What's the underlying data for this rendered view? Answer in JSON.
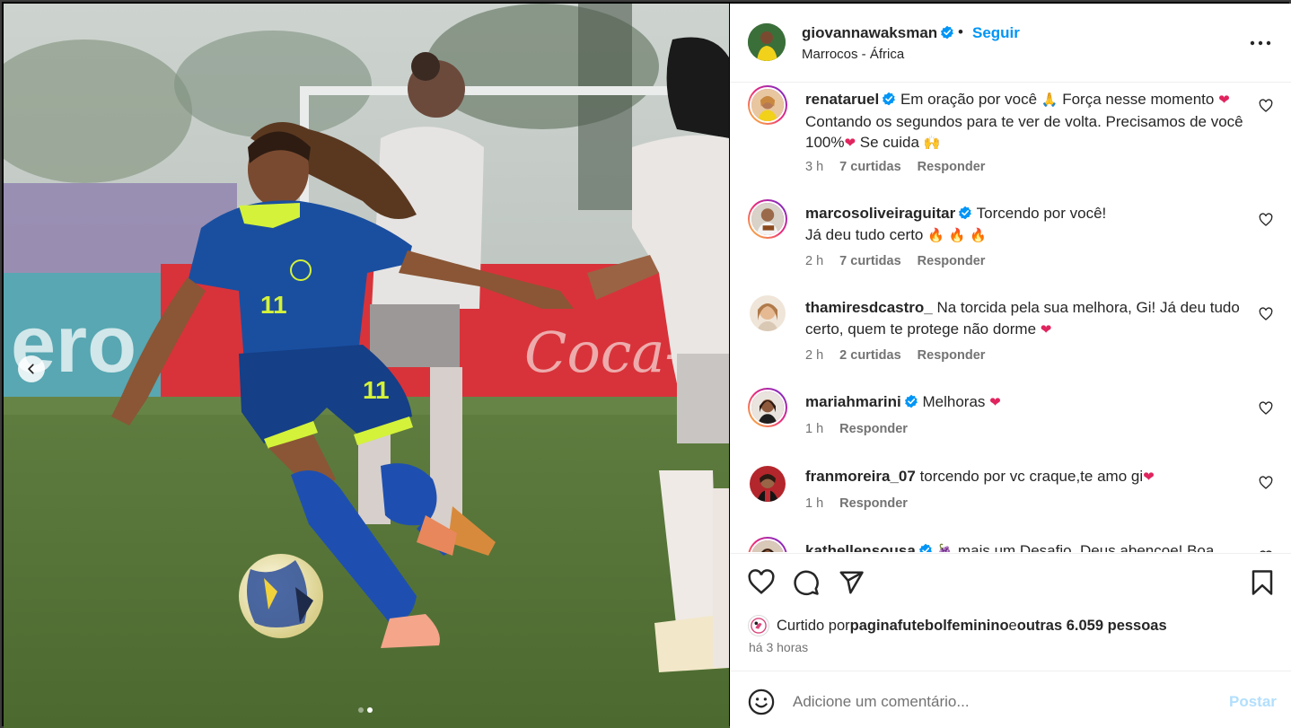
{
  "post": {
    "username": "giovannawaksman",
    "separator": "•",
    "follow_label": "Seguir",
    "location": "Marrocos - África"
  },
  "comments": [
    {
      "username": "renataruel",
      "text_a": "Em oração por você ",
      "emoji_a": "🙏",
      "text_b": " Força nesse momento ",
      "emoji_b": "❤",
      "text_c": " Contando os segundos para te ver de volta. Precisamos de você 100%",
      "emoji_c": "❤",
      "text_d": " Se cuida ",
      "emoji_d": "🙌",
      "time": "3 h",
      "likes": "7 curtidas",
      "reply": "Responder"
    },
    {
      "username": "marcosoliveiraguitar",
      "text_a": "Torcendo por você!",
      "text_b": "Já deu tudo certo ",
      "emoji_a": "🔥 🔥 🔥",
      "time": "2 h",
      "likes": "7 curtidas",
      "reply": "Responder"
    },
    {
      "username": "thamiresdcastro_",
      "text_a": "Na torcida pela sua melhora, Gi! Já deu tudo certo, quem te protege não dorme ",
      "emoji_a": "❤",
      "time": "2 h",
      "likes": "2 curtidas",
      "reply": "Responder"
    },
    {
      "username": "mariahmarini",
      "text_a": "Melhoras ",
      "emoji_a": "❤",
      "time": "1 h",
      "reply": "Responder"
    },
    {
      "username": "franmoreira_07",
      "text_a": "torcendo por vc craque,te amo gi",
      "emoji_a": "❤",
      "time": "1 h",
      "reply": "Responder"
    },
    {
      "username": "kathellensousa",
      "emoji_a": "🍇",
      "text_a": " mais um Desafio, Deus abençoe! Boa"
    }
  ],
  "actions": {
    "liked_prefix": "Curtido por ",
    "liked_user": "paginafutebolfeminino",
    "liked_mid": " e ",
    "liked_others": "outras 6.059 pessoas",
    "post_time": "há 3 horas"
  },
  "composer": {
    "placeholder": "Adicione um comentário...",
    "post_label": "Postar"
  },
  "colors": {
    "accent": "#0095f6",
    "jersey": "#1a4fa0",
    "neon": "#d4f23a",
    "heart": "#e0245e"
  },
  "carousel": {
    "slide_count": 2,
    "active_slide": 2
  }
}
